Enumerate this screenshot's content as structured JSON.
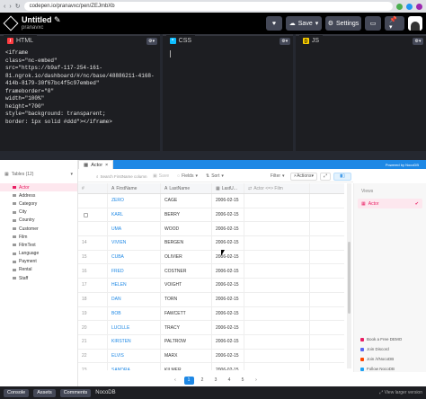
{
  "browser": {
    "url": "codepen.io/pranavxc/pen/ZEJmbXb"
  },
  "codepen": {
    "title": "Untitled",
    "author": "pranavxc",
    "save_label": "Save",
    "settings_label": "Settings",
    "panes": [
      {
        "label": "HTML",
        "badge_color": "#ff3c41"
      },
      {
        "label": "CSS",
        "badge_color": "#0ebeff"
      },
      {
        "label": "JS",
        "badge_color": "#fcd000"
      }
    ],
    "html_code": [
      "<iframe",
      "class=\"nc-embed\"",
      "src=\"https://b9af-117-254-161-",
      "81.ngrok.io/dashboard/#/nc/base/48886211-4168-",
      "414b-8179-30f67bc4f5c97embed\"",
      "frameborder=\"0\"",
      "width=\"100%\"",
      "height=\"700\"",
      "style=\"background: transparent;",
      "border: 1px solid #ddd\"></iframe>"
    ],
    "footer": {
      "console_label": "Console",
      "assets_label": "Assets",
      "comments_label": "Comments",
      "title": "NocoDB",
      "right": "View larger version"
    }
  },
  "nocodb": {
    "powered_by": "Powered by NocoDB",
    "tab_label": "Actor",
    "sidebar": {
      "header": "Tables (12)",
      "items": [
        "Actor",
        "Address",
        "Category",
        "City",
        "Country",
        "Customer",
        "Film",
        "FilmText",
        "Language",
        "Payment",
        "Rental",
        "Staff"
      ]
    },
    "toolbar": {
      "search_placeholder": "Search FirstName column",
      "save": "Save",
      "fields": "Fields",
      "sort": "Sort",
      "filter": "Filter",
      "actions": "Actions"
    },
    "columns": [
      "#",
      "FirstName",
      "LastName",
      "LastU...",
      "Actor <=> Film"
    ],
    "rows": [
      {
        "id": "",
        "first": "ZERO",
        "last": "CAGE",
        "date": "2006-02-15"
      },
      {
        "id": "",
        "first": "KARL",
        "last": "BERRY",
        "date": "2006-02-15"
      },
      {
        "id": "",
        "first": "UMA",
        "last": "WOOD",
        "date": "2006-02-15"
      },
      {
        "id": "14",
        "first": "VIVIEN",
        "last": "BERGEN",
        "date": "2006-02-15"
      },
      {
        "id": "15",
        "first": "CUBA",
        "last": "OLIVIER",
        "date": "2006-02-15"
      },
      {
        "id": "16",
        "first": "FRED",
        "last": "COSTNER",
        "date": "2006-02-15"
      },
      {
        "id": "17",
        "first": "HELEN",
        "last": "VOIGHT",
        "date": "2006-02-15"
      },
      {
        "id": "18",
        "first": "DAN",
        "last": "TORN",
        "date": "2006-02-15"
      },
      {
        "id": "19",
        "first": "BOB",
        "last": "FAWCETT",
        "date": "2006-02-15"
      },
      {
        "id": "20",
        "first": "LUCILLE",
        "last": "TRACY",
        "date": "2006-02-15"
      },
      {
        "id": "21",
        "first": "KIRSTEN",
        "last": "PALTROW",
        "date": "2006-02-15"
      },
      {
        "id": "22",
        "first": "ELVIS",
        "last": "MARX",
        "date": "2006-02-15"
      },
      {
        "id": "23",
        "first": "SANDRA",
        "last": "KILMER",
        "date": "2006-02-15"
      }
    ],
    "pagination": [
      "‹",
      "1",
      "2",
      "3",
      "4",
      "5",
      "›"
    ],
    "views": {
      "title": "Views",
      "items": [
        "Actor"
      ]
    },
    "links": [
      {
        "label": "Book a Free DEMO",
        "color": "#e91e63"
      },
      {
        "label": "Join Discord",
        "color": "#5865f2"
      },
      {
        "label": "Join /r/NocoDB",
        "color": "#ff4500"
      },
      {
        "label": "Follow NocoDB",
        "color": "#1da1f2"
      }
    ]
  }
}
